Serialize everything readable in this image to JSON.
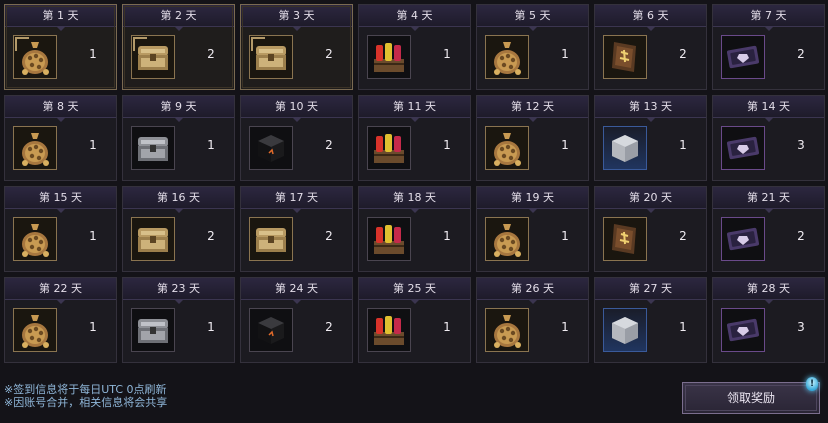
{
  "days": [
    {
      "label": "第 1 天",
      "item": "coin-bag-icon",
      "qty": "1",
      "claimed": true
    },
    {
      "label": "第 2 天",
      "item": "gold-chest-icon",
      "qty": "2",
      "claimed": true
    },
    {
      "label": "第 3 天",
      "item": "gold-chest-icon",
      "qty": "2",
      "claimed": true
    },
    {
      "label": "第 4 天",
      "item": "potion-crate-icon",
      "qty": "1",
      "claimed": false
    },
    {
      "label": "第 5 天",
      "item": "coin-bag-icon",
      "qty": "1",
      "claimed": false
    },
    {
      "label": "第 6 天",
      "item": "scroll-icon",
      "qty": "2",
      "claimed": false
    },
    {
      "label": "第 7 天",
      "item": "purple-ticket-icon",
      "qty": "2",
      "claimed": false
    },
    {
      "label": "第 8 天",
      "item": "coin-bag-icon",
      "qty": "1",
      "claimed": false
    },
    {
      "label": "第 9 天",
      "item": "silver-chest-icon",
      "qty": "1",
      "claimed": false
    },
    {
      "label": "第 10 天",
      "item": "dark-cube-icon",
      "qty": "2",
      "claimed": false
    },
    {
      "label": "第 11 天",
      "item": "potion-crate-icon",
      "qty": "1",
      "claimed": false
    },
    {
      "label": "第 12 天",
      "item": "coin-bag-icon",
      "qty": "1",
      "claimed": false
    },
    {
      "label": "第 13 天",
      "item": "silver-box-icon",
      "qty": "1",
      "claimed": false
    },
    {
      "label": "第 14 天",
      "item": "purple-ticket-icon",
      "qty": "3",
      "claimed": false
    },
    {
      "label": "第 15 天",
      "item": "coin-bag-icon",
      "qty": "1",
      "claimed": false
    },
    {
      "label": "第 16 天",
      "item": "gold-chest-icon",
      "qty": "2",
      "claimed": false
    },
    {
      "label": "第 17 天",
      "item": "gold-chest-icon",
      "qty": "2",
      "claimed": false
    },
    {
      "label": "第 18 天",
      "item": "potion-crate-icon",
      "qty": "1",
      "claimed": false
    },
    {
      "label": "第 19 天",
      "item": "coin-bag-icon",
      "qty": "1",
      "claimed": false
    },
    {
      "label": "第 20 天",
      "item": "scroll-icon",
      "qty": "2",
      "claimed": false
    },
    {
      "label": "第 21 天",
      "item": "purple-ticket-icon",
      "qty": "2",
      "claimed": false
    },
    {
      "label": "第 22 天",
      "item": "coin-bag-icon",
      "qty": "1",
      "claimed": false
    },
    {
      "label": "第 23 天",
      "item": "silver-chest-icon",
      "qty": "1",
      "claimed": false
    },
    {
      "label": "第 24 天",
      "item": "dark-cube-icon",
      "qty": "2",
      "claimed": false
    },
    {
      "label": "第 25 天",
      "item": "potion-crate-icon",
      "qty": "1",
      "claimed": false
    },
    {
      "label": "第 26 天",
      "item": "coin-bag-icon",
      "qty": "1",
      "claimed": false
    },
    {
      "label": "第 27 天",
      "item": "silver-box-icon",
      "qty": "1",
      "claimed": false
    },
    {
      "label": "第 28 天",
      "item": "purple-ticket-icon",
      "qty": "3",
      "claimed": false
    }
  ],
  "notes": [
    "※签到信息将于每日UTC 0点刷新",
    "※因账号合并，相关信息将会共享"
  ],
  "claim_button": "领取奖励",
  "notification_badge": "!"
}
